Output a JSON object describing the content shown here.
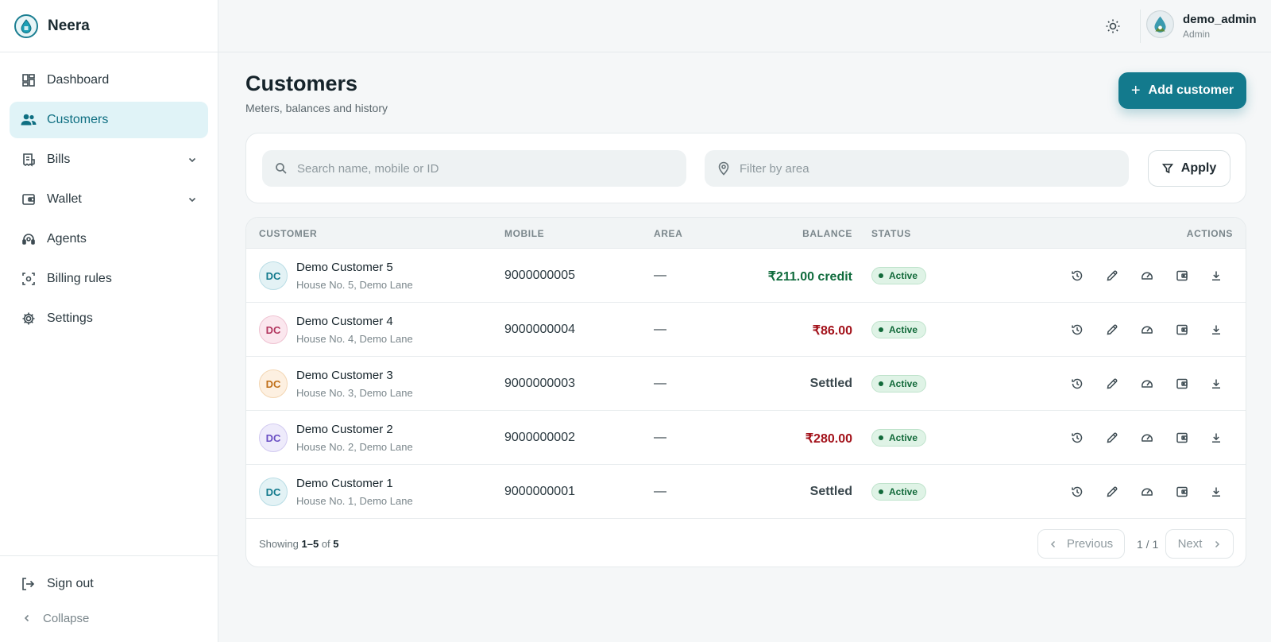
{
  "brand": {
    "name": "Neera"
  },
  "nav": {
    "items": [
      {
        "label": "Dashboard",
        "icon": "dashboard-icon",
        "active": false,
        "expandable": false
      },
      {
        "label": "Customers",
        "icon": "users-icon",
        "active": true,
        "expandable": false
      },
      {
        "label": "Bills",
        "icon": "receipt-icon",
        "active": false,
        "expandable": true
      },
      {
        "label": "Wallet",
        "icon": "wallet-icon",
        "active": false,
        "expandable": true
      },
      {
        "label": "Agents",
        "icon": "headset-icon",
        "active": false,
        "expandable": false
      },
      {
        "label": "Billing rules",
        "icon": "rules-icon",
        "active": false,
        "expandable": false
      },
      {
        "label": "Settings",
        "icon": "gear-icon",
        "active": false,
        "expandable": false
      }
    ],
    "sign_out": "Sign out",
    "collapse": "Collapse"
  },
  "user": {
    "name": "demo_admin",
    "role": "Admin"
  },
  "page": {
    "title": "Customers",
    "subtitle": "Meters, balances and history",
    "add_button": "Add customer"
  },
  "filters": {
    "search_placeholder": "Search name, mobile or ID",
    "area_placeholder": "Filter by area",
    "apply": "Apply"
  },
  "table": {
    "columns": {
      "customer": "CUSTOMER",
      "mobile": "MOBILE",
      "area": "AREA",
      "balance": "BALANCE",
      "status": "STATUS",
      "actions": "ACTIONS"
    },
    "rows": [
      {
        "initials": "DC",
        "name": "Demo Customer 5",
        "address": "House No. 5, Demo Lane",
        "mobile": "9000000005",
        "area": "—",
        "balance": "₹211.00 credit",
        "balance_kind": "credit",
        "status": "Active",
        "avatar_bg": "#e3f2f5",
        "avatar_fg": "#137a8d",
        "avatar_border": "#b9dde5"
      },
      {
        "initials": "DC",
        "name": "Demo Customer 4",
        "address": "House No. 4, Demo Lane",
        "mobile": "9000000004",
        "area": "—",
        "balance": "₹86.00",
        "balance_kind": "due",
        "status": "Active",
        "avatar_bg": "#fbe7ee",
        "avatar_fg": "#b2365f",
        "avatar_border": "#efc3d2"
      },
      {
        "initials": "DC",
        "name": "Demo Customer 3",
        "address": "House No. 3, Demo Lane",
        "mobile": "9000000003",
        "area": "—",
        "balance": "Settled",
        "balance_kind": "settled",
        "status": "Active",
        "avatar_bg": "#fdf0e1",
        "avatar_fg": "#c0701a",
        "avatar_border": "#f3d6b3"
      },
      {
        "initials": "DC",
        "name": "Demo Customer 2",
        "address": "House No. 2, Demo Lane",
        "mobile": "9000000002",
        "area": "—",
        "balance": "₹280.00",
        "balance_kind": "due",
        "status": "Active",
        "avatar_bg": "#eeebfb",
        "avatar_fg": "#6a4fc4",
        "avatar_border": "#d2caf1"
      },
      {
        "initials": "DC",
        "name": "Demo Customer 1",
        "address": "House No. 1, Demo Lane",
        "mobile": "9000000001",
        "area": "—",
        "balance": "Settled",
        "balance_kind": "settled",
        "status": "Active",
        "avatar_bg": "#e3f2f5",
        "avatar_fg": "#137a8d",
        "avatar_border": "#b9dde5"
      }
    ],
    "row_actions": [
      "history-icon",
      "edit-icon",
      "meter-icon",
      "wallet-icon",
      "download-icon"
    ]
  },
  "pagination": {
    "showing_prefix": "Showing",
    "range": "1–5",
    "of_word": "of",
    "total": "5",
    "previous": "Previous",
    "page_info": "1 / 1",
    "next": "Next"
  },
  "colors": {
    "accent": "#137a8d",
    "credit": "#0f6b3c",
    "due": "#a3121b",
    "active_badge": "#dff3e6"
  }
}
